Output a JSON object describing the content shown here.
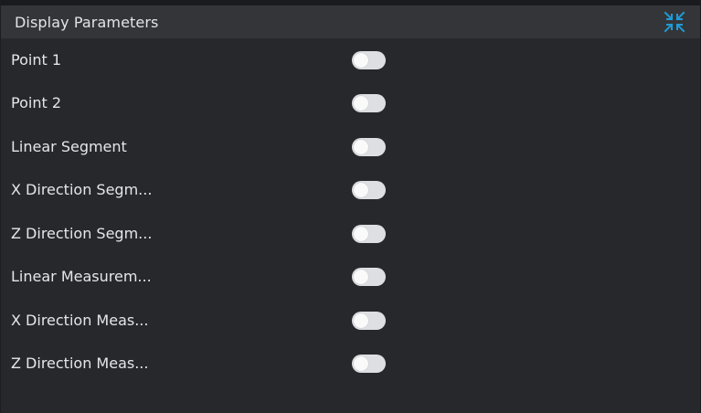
{
  "panel": {
    "title": "Display Parameters",
    "collapse_icon": "collapse-arrows-icon",
    "accent_color": "#1e9bd7"
  },
  "parameters": [
    {
      "label": "Point 1",
      "enabled": false
    },
    {
      "label": "Point 2",
      "enabled": false
    },
    {
      "label": "Linear Segment",
      "enabled": false
    },
    {
      "label": "X Direction Segm...",
      "enabled": false
    },
    {
      "label": "Z Direction Segm...",
      "enabled": false
    },
    {
      "label": "Linear Measurem...",
      "enabled": false
    },
    {
      "label": "X Direction Meas...",
      "enabled": false
    },
    {
      "label": "Z Direction Meas...",
      "enabled": false
    }
  ]
}
